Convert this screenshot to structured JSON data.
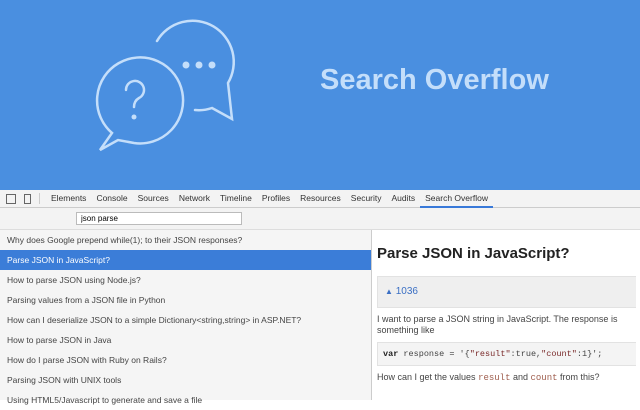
{
  "banner": {
    "title": "Search Overflow",
    "logo": "chat-bubbles-icon"
  },
  "toolbar": {
    "tabs": [
      "Elements",
      "Console",
      "Sources",
      "Network",
      "Timeline",
      "Profiles",
      "Resources",
      "Security",
      "Audits",
      "Search Overflow"
    ],
    "active": "Search Overflow"
  },
  "search": {
    "value": "json parse"
  },
  "results": [
    "Why does Google prepend while(1); to their JSON responses?",
    "Parse JSON in JavaScript?",
    "How to parse JSON using Node.js?",
    "Parsing values from a JSON file in Python",
    "How can I deserialize JSON to a simple Dictionary<string,string> in ASP.NET?",
    "How to parse JSON in Java",
    "How do I parse JSON with Ruby on Rails?",
    "Parsing JSON with UNIX tools",
    "Using HTML5/Javascript to generate and save a file"
  ],
  "selected_index": 1,
  "question": {
    "title": "Parse JSON in JavaScript?",
    "votes": "1036",
    "body1": "I want to parse a JSON string in JavaScript. The response is something like",
    "code": {
      "kw": "var",
      "rest": " response = '{",
      "k1": "\"result\"",
      "m1": ":true,",
      "k2": "\"count\"",
      "m2": ":1}';"
    },
    "body2_a": "How can I get the values ",
    "body2_b": "result",
    "body2_c": " and ",
    "body2_d": "count",
    "body2_e": " from this?"
  },
  "colors": {
    "banner": "#4a8fe0",
    "accent": "#3b7dd8"
  }
}
